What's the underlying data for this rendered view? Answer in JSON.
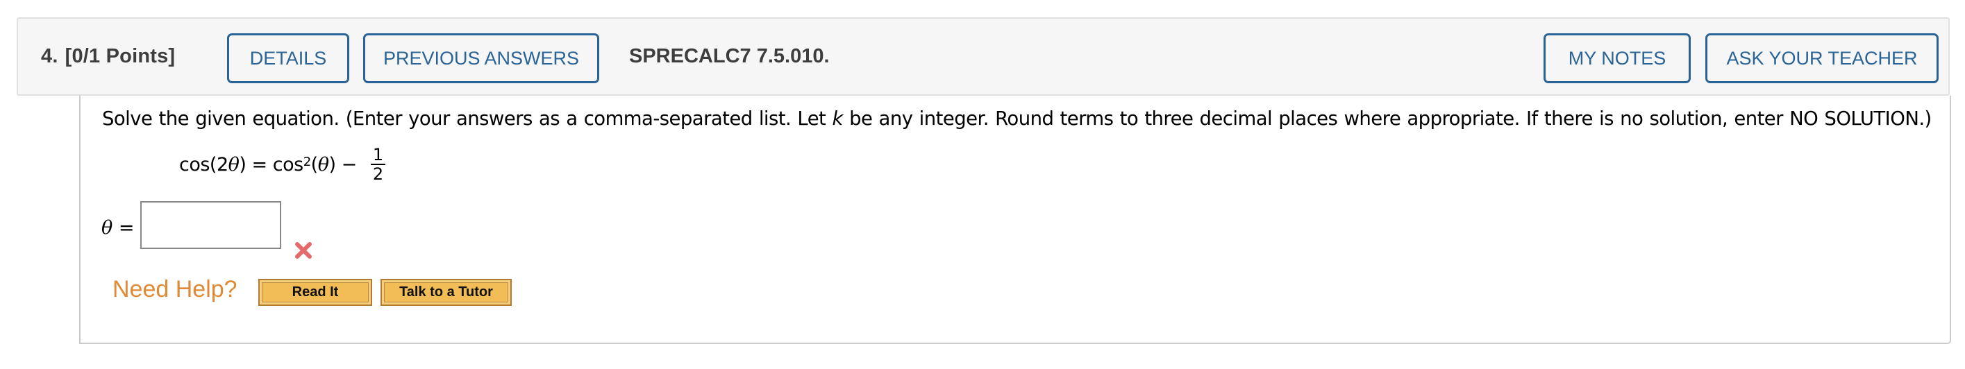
{
  "header": {
    "question_number": "4.",
    "points": "[0/1 Points]",
    "buttons": {
      "details": "DETAILS",
      "previous_answers": "PREVIOUS ANSWERS",
      "my_notes": "MY NOTES",
      "ask_teacher": "ASK YOUR TEACHER"
    },
    "problem_code": "SPRECALC7 7.5.010."
  },
  "question": {
    "instruction_before_k": "Solve the given equation. (Enter your answers as a comma-separated list. Let ",
    "k_var": "k",
    "instruction_after_k": " be any integer. Round terms to three decimal places where appropriate. If there is no solution, enter NO SOLUTION.)",
    "equation": {
      "lhs_func": "cos(2",
      "lhs_var": "θ",
      "lhs_close": ")",
      "equals": " = ",
      "rhs_func": "cos",
      "rhs_exp": "2",
      "rhs_open": "(",
      "rhs_var": "θ",
      "rhs_close": ")",
      "minus": " − ",
      "frac_num": "1",
      "frac_den": "2"
    },
    "answer_label_var": "θ",
    "answer_label_eq": " =",
    "answer_value": "",
    "answer_status": "incorrect",
    "status_color": "#e55a5a"
  },
  "help": {
    "label": "Need Help?",
    "read_it": "Read It",
    "talk_tutor": "Talk to a Tutor"
  },
  "colors": {
    "accent": "#2a6496",
    "help_orange": "#e08a35",
    "help_button": "#f2bc57"
  }
}
